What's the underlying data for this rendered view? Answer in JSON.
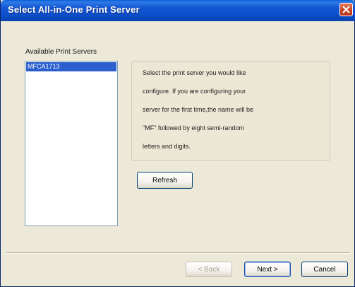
{
  "window": {
    "title": "Select All-in-One Print Server"
  },
  "icons": {
    "close": "close-icon"
  },
  "servers_section": {
    "label": "Available Print Servers",
    "items": [
      "MFCA1713"
    ],
    "selected_index": 0
  },
  "info": {
    "lines": [
      "Select the print server you would like",
      "configure. If you are configuring your",
      "server for the first time,the name will be",
      "\"MF\" followed by eight semi-random",
      "letters and digits."
    ]
  },
  "buttons": {
    "refresh": "Refresh",
    "back": "< Back",
    "next": "Next >",
    "cancel": "Cancel"
  },
  "colors": {
    "titlebar": "#0d4fc9",
    "selection": "#2c5fce",
    "close": "#c9401f"
  }
}
